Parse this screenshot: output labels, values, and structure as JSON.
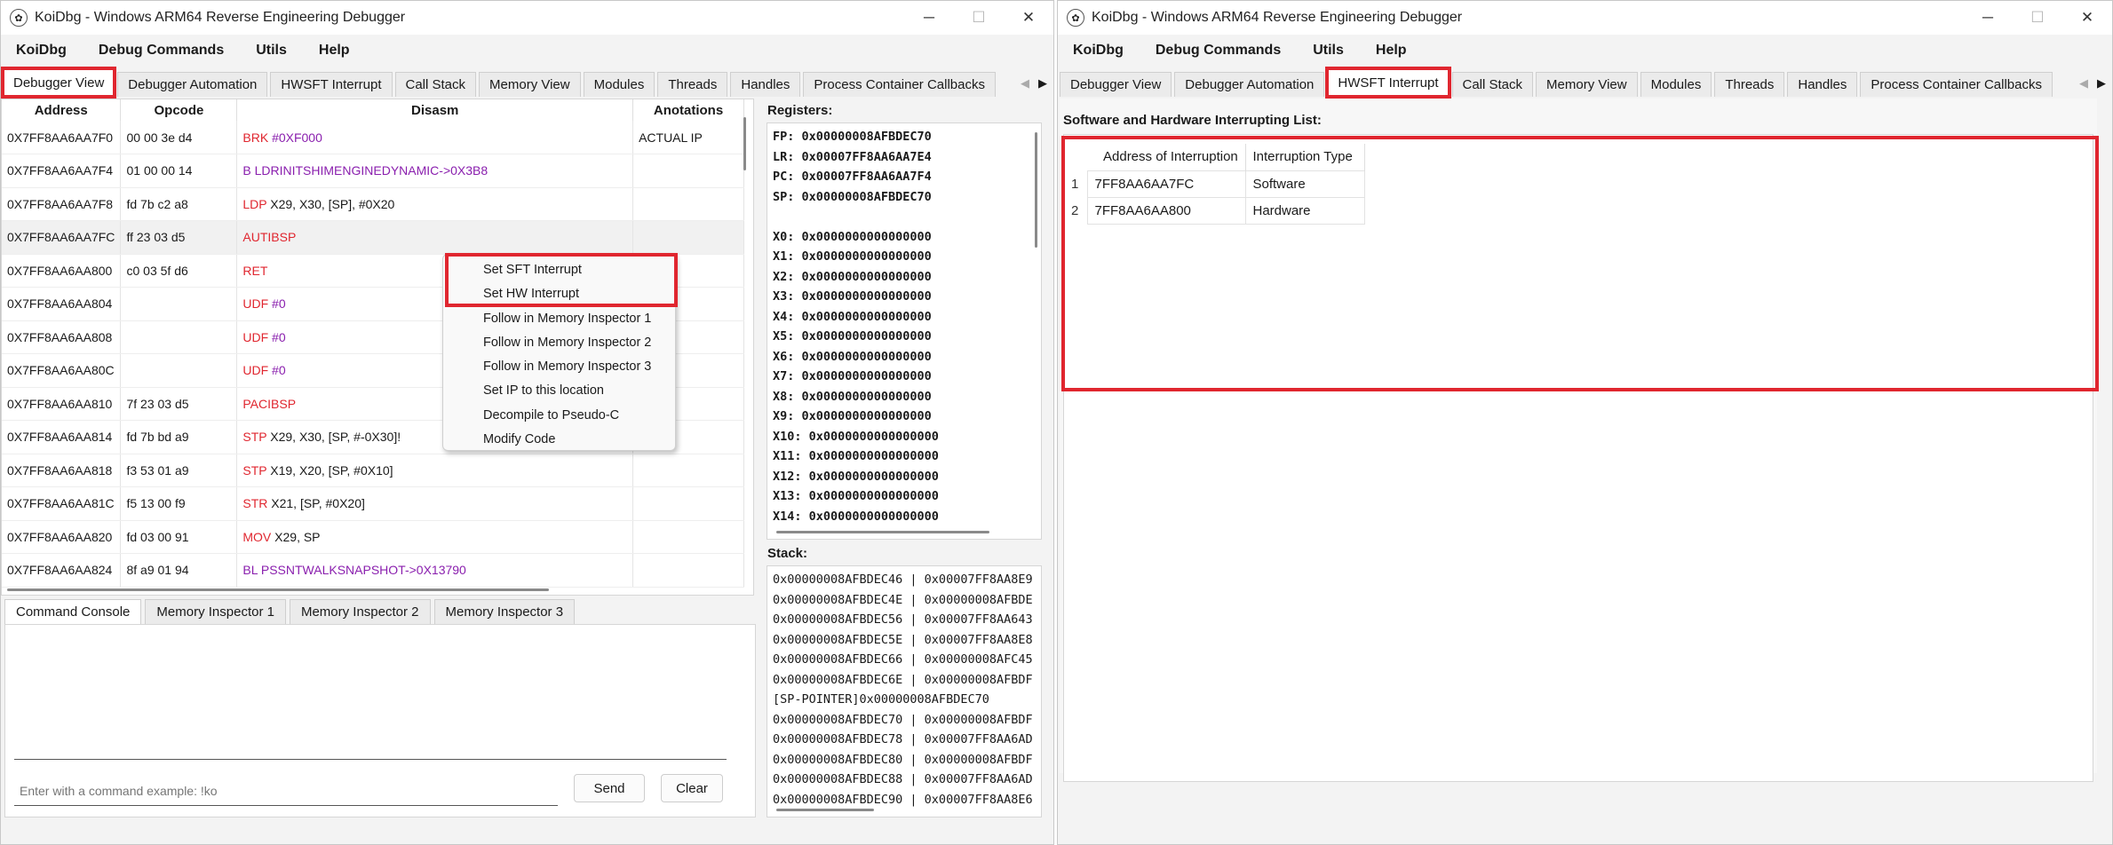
{
  "window_left": {
    "title": "KoiDbg - Windows ARM64 Reverse Engineering Debugger",
    "menu": [
      "KoiDbg",
      "Debug Commands",
      "Utils",
      "Help"
    ],
    "tabs": [
      "Debugger View",
      "Debugger Automation",
      "HWSFT Interrupt",
      "Call Stack",
      "Memory View",
      "Modules",
      "Threads",
      "Handles",
      "Process Container Callbacks"
    ],
    "disasm": {
      "headers": [
        "Address",
        "Opcode",
        "Disasm",
        "Anotations"
      ],
      "rows": [
        {
          "address": "0X7FF8AA6AA7F0",
          "opcode": "00 00 3e d4",
          "mnemonic": "BRK",
          "operands": "#0XF000",
          "kind": "red-purple",
          "annotation": "ACTUAL IP"
        },
        {
          "address": "0X7FF8AA6AA7F4",
          "opcode": "01 00 00 14",
          "mnemonic": "B",
          "operands": "LDRINITSHIMENGINEDYNAMIC->0X3B8",
          "kind": "branch",
          "annotation": ""
        },
        {
          "address": "0X7FF8AA6AA7F8",
          "opcode": "fd 7b c2 a8",
          "mnemonic": "LDP",
          "operands": "X29, X30, [SP], #0X20",
          "kind": "red",
          "annotation": ""
        },
        {
          "address": "0X7FF8AA6AA7FC",
          "opcode": "ff 23 03 d5",
          "mnemonic": "AUTIBSP",
          "operands": "",
          "kind": "red",
          "annotation": ""
        },
        {
          "address": "0X7FF8AA6AA800",
          "opcode": "c0 03 5f d6",
          "mnemonic": "RET",
          "operands": "",
          "kind": "red",
          "annotation": ""
        },
        {
          "address": "0X7FF8AA6AA804",
          "opcode": "",
          "mnemonic": "UDF",
          "operands": "#0",
          "kind": "red-purple",
          "annotation": ""
        },
        {
          "address": "0X7FF8AA6AA808",
          "opcode": "",
          "mnemonic": "UDF",
          "operands": "#0",
          "kind": "red-purple",
          "annotation": ""
        },
        {
          "address": "0X7FF8AA6AA80C",
          "opcode": "",
          "mnemonic": "UDF",
          "operands": "#0",
          "kind": "red-purple",
          "annotation": ""
        },
        {
          "address": "0X7FF8AA6AA810",
          "opcode": "7f 23 03 d5",
          "mnemonic": "PACIBSP",
          "operands": "",
          "kind": "red",
          "annotation": ""
        },
        {
          "address": "0X7FF8AA6AA814",
          "opcode": "fd 7b bd a9",
          "mnemonic": "STP",
          "operands": "X29, X30, [SP, #-0X30]!",
          "kind": "red",
          "annotation": ""
        },
        {
          "address": "0X7FF8AA6AA818",
          "opcode": "f3 53 01 a9",
          "mnemonic": "STP",
          "operands": "X19, X20, [SP, #0X10]",
          "kind": "red",
          "annotation": ""
        },
        {
          "address": "0X7FF8AA6AA81C",
          "opcode": "f5 13 00 f9",
          "mnemonic": "STR",
          "operands": "X21, [SP, #0X20]",
          "kind": "red",
          "annotation": ""
        },
        {
          "address": "0X7FF8AA6AA820",
          "opcode": "fd 03 00 91",
          "mnemonic": "MOV",
          "operands": "X29, SP",
          "kind": "red",
          "annotation": ""
        },
        {
          "address": "0X7FF8AA6AA824",
          "opcode": "8f a9 01 94",
          "mnemonic": "BL",
          "operands": "PSSNTWALKSNAPSHOT->0X13790",
          "kind": "branch",
          "annotation": ""
        }
      ]
    },
    "context_menu": [
      "Set SFT Interrupt",
      "Set HW Interrupt",
      "Follow in Memory Inspector 1",
      "Follow in Memory Inspector 2",
      "Follow in Memory Inspector 3",
      "Set IP to this location",
      "Decompile to Pseudo-C",
      "Modify Code"
    ],
    "registers_label": "Registers:",
    "registers": [
      "FP: 0x00000008AFBDEC70",
      "LR: 0x00007FF8AA6AA7E4",
      "PC: 0x00007FF8AA6AA7F4",
      "SP: 0x00000008AFBDEC70",
      "",
      "X0: 0x0000000000000000",
      "X1: 0x0000000000000000",
      "X2: 0x0000000000000000",
      "X3: 0x0000000000000000",
      "X4: 0x0000000000000000",
      "X5: 0x0000000000000000",
      "X6: 0x0000000000000000",
      "X7: 0x0000000000000000",
      "X8: 0x0000000000000000",
      "X9: 0x0000000000000000",
      "X10: 0x0000000000000000",
      "X11: 0x0000000000000000",
      "X12: 0x0000000000000000",
      "X13: 0x0000000000000000",
      "X14: 0x0000000000000000"
    ],
    "stack_label": "Stack:",
    "stack": [
      "0x00000008AFBDEC46 | 0x00007FF8AA8E9",
      "0x00000008AFBDEC4E | 0x00000008AFBDE",
      "0x00000008AFBDEC56 | 0x00007FF8AA643",
      "0x00000008AFBDEC5E | 0x00007FF8AA8E8",
      "0x00000008AFBDEC66 | 0x00000008AFC45",
      "0x00000008AFBDEC6E | 0x00000008AFBDF",
      "[SP-POINTER]0x00000008AFBDEC70",
      "0x00000008AFBDEC70 | 0x00000008AFBDF",
      "0x00000008AFBDEC78 | 0x00007FF8AA6AD",
      "0x00000008AFBDEC80 | 0x00000008AFBDF",
      "0x00000008AFBDEC88 | 0x00007FF8AA6AD",
      "0x00000008AFBDEC90 | 0x00007FF8AA8E6"
    ],
    "bottom_tabs": [
      "Command Console",
      "Memory Inspector 1",
      "Memory Inspector 2",
      "Memory Inspector 3"
    ],
    "command_placeholder": "Enter with a command example: !ko",
    "send_label": "Send",
    "clear_label": "Clear"
  },
  "window_right": {
    "title": "KoiDbg - Windows ARM64 Reverse Engineering Debugger",
    "menu": [
      "KoiDbg",
      "Debug Commands",
      "Utils",
      "Help"
    ],
    "tabs": [
      "Debugger View",
      "Debugger Automation",
      "HWSFT Interrupt",
      "Call Stack",
      "Memory View",
      "Modules",
      "Threads",
      "Handles",
      "Process Container Callbacks"
    ],
    "list_label": "Software and Hardware Interrupting List:",
    "headers": [
      "Address of Interruption",
      "Interruption Type"
    ],
    "rows": [
      {
        "index": "1",
        "address": "7FF8AA6AA7FC",
        "type": "Software"
      },
      {
        "index": "2",
        "address": "7FF8AA6AA800",
        "type": "Hardware"
      }
    ]
  },
  "colors": {
    "highlight": "#e0262f",
    "mnemonic": "#e0262f",
    "branch": "#8a1fae"
  }
}
